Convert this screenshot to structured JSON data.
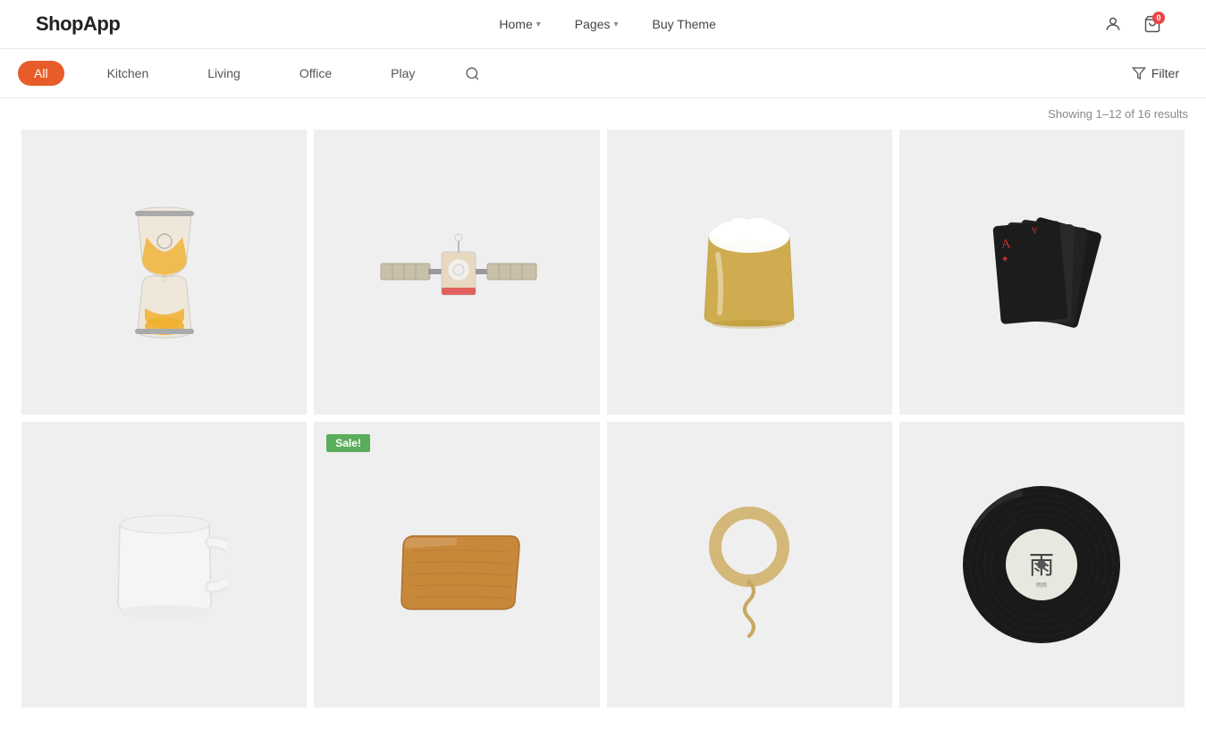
{
  "header": {
    "logo": "ShopApp",
    "nav": [
      {
        "label": "Home",
        "hasDropdown": true
      },
      {
        "label": "Pages",
        "hasDropdown": true
      }
    ],
    "buyTheme": "Buy Theme",
    "cartCount": "0"
  },
  "categories": {
    "items": [
      {
        "label": "All",
        "active": true
      },
      {
        "label": "Kitchen"
      },
      {
        "label": "Living"
      },
      {
        "label": "Office"
      },
      {
        "label": "Play"
      }
    ],
    "filterLabel": "Filter",
    "resultsText": "Showing 1–12 of 16 results"
  },
  "products": [
    {
      "id": 1,
      "type": "hourglass",
      "sale": false
    },
    {
      "id": 2,
      "type": "satellite",
      "sale": false
    },
    {
      "id": 3,
      "type": "beer",
      "sale": false
    },
    {
      "id": 4,
      "type": "cards",
      "sale": false
    },
    {
      "id": 5,
      "type": "mug",
      "sale": false
    },
    {
      "id": 6,
      "type": "wood",
      "sale": true
    },
    {
      "id": 7,
      "type": "ring",
      "sale": false
    },
    {
      "id": 8,
      "type": "vinyl",
      "sale": false
    }
  ]
}
